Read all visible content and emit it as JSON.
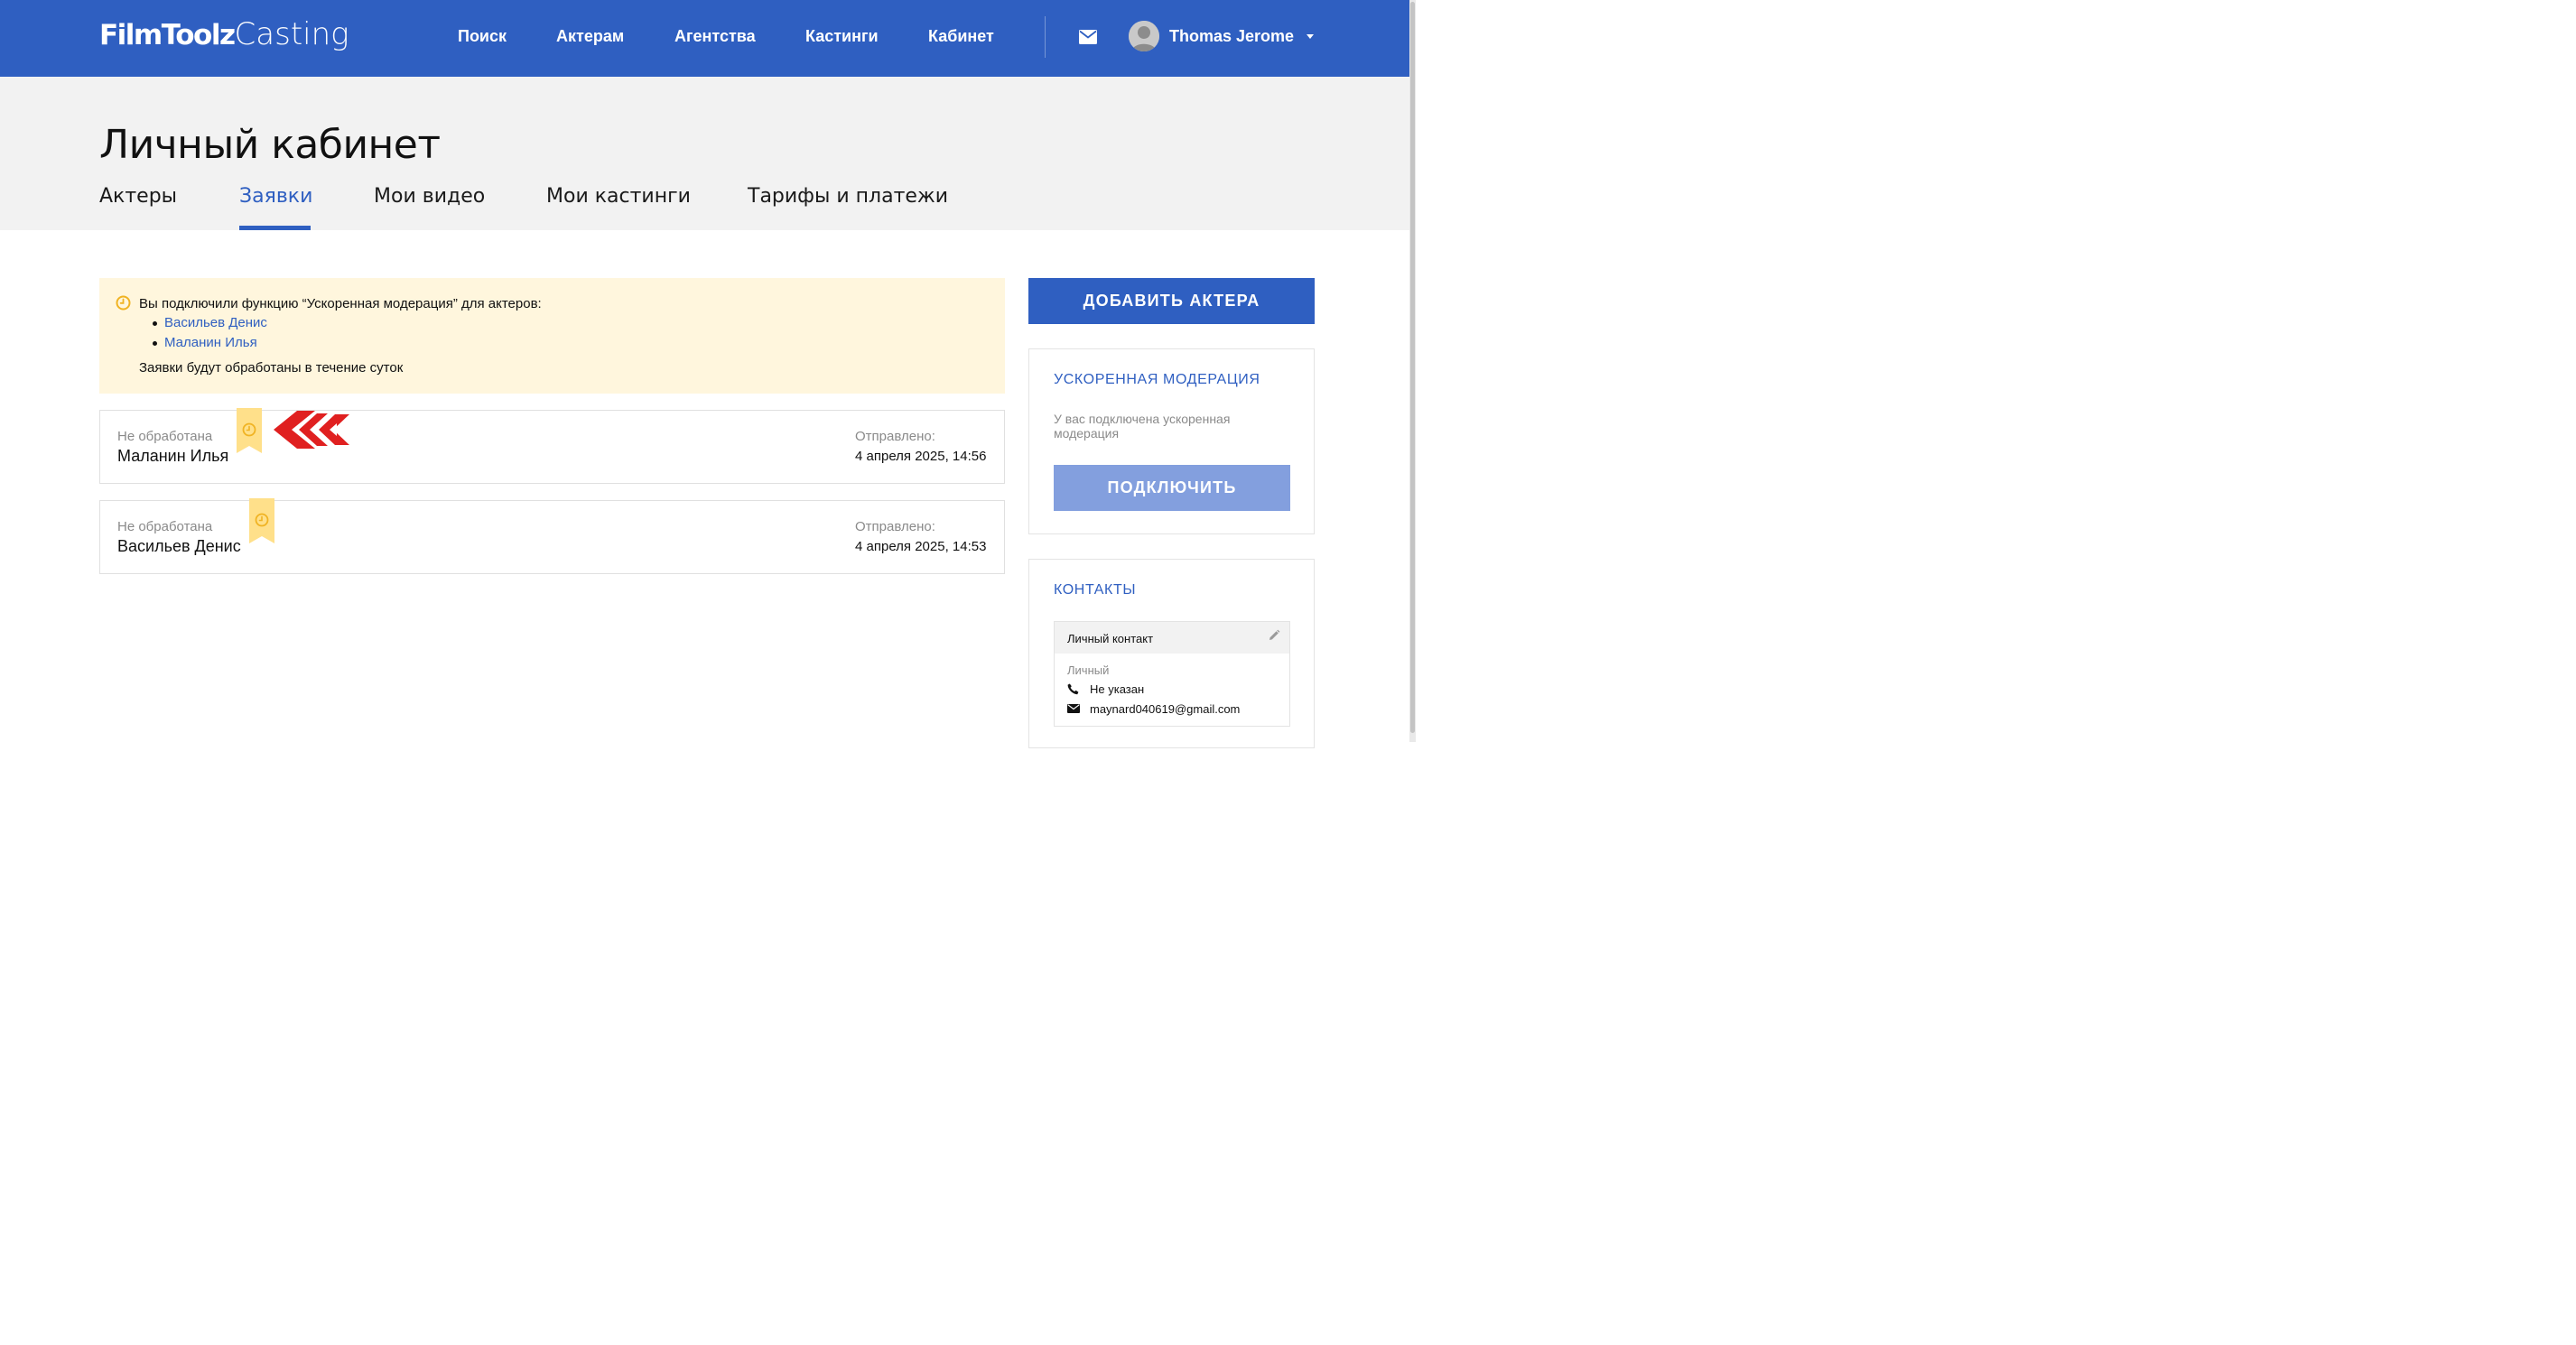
{
  "brand": {
    "logo_bold": "FilmToolz",
    "logo_light": "Casting"
  },
  "nav": {
    "items": [
      {
        "label": "Поиск"
      },
      {
        "label": "Актерам"
      },
      {
        "label": "Агентства"
      },
      {
        "label": "Кастинги"
      },
      {
        "label": "Кабинет"
      }
    ],
    "mail_icon": "envelope-icon",
    "user_name": "Thomas Jerome"
  },
  "page": {
    "title": "Личный кабинет",
    "tabs": [
      {
        "label": "Актеры",
        "active": false
      },
      {
        "label": "Заявки",
        "active": true
      },
      {
        "label": "Мои видео",
        "active": false
      },
      {
        "label": "Мои кастинги",
        "active": false
      },
      {
        "label": "Тарифы и платежи",
        "active": false
      }
    ]
  },
  "notice": {
    "text": "Вы подключили функцию “Ускоренная модерация” для актеров:",
    "actors": [
      "Васильев Денис",
      "Маланин Илья"
    ],
    "footer": "Заявки будут обработаны в течение суток"
  },
  "applications": [
    {
      "status": "Не обработана",
      "name": "Маланин Илья",
      "sent_label": "Отправлено:",
      "sent_date": "4 апреля 2025, 14:56"
    },
    {
      "status": "Не обработана",
      "name": "Васильев Денис",
      "sent_label": "Отправлено:",
      "sent_date": "4 апреля 2025, 14:53"
    }
  ],
  "sidebar": {
    "add_actor_label": "ДОБАВИТЬ АКТЕРА",
    "moderation": {
      "title": "УСКОРЕННАЯ МОДЕРАЦИЯ",
      "description": "У вас подключена ускоренная модерация",
      "connect_label": "ПОДКЛЮЧИТЬ"
    },
    "contacts": {
      "title": "КОНТАКТЫ",
      "card_title": "Личный контакт",
      "type": "Личный",
      "phone": "Не указан",
      "email": "maynard040619@gmail.com"
    }
  },
  "colors": {
    "primary": "#2f5fc1",
    "notice_bg": "#fff6dd",
    "ribbon": "#ffe08a",
    "clock": "#f0b323",
    "annotation_arrow": "#e02020",
    "button_disabled": "#839fde"
  }
}
